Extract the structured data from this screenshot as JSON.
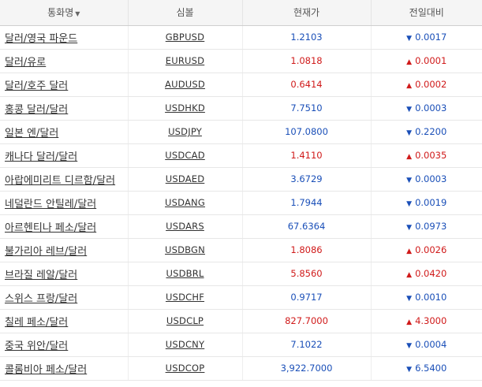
{
  "header": {
    "name": "통화명",
    "sort_icon": "▼",
    "symbol": "심볼",
    "price": "현재가",
    "change": "전일대비"
  },
  "colors": {
    "up": "#d01a1a",
    "down": "#1a4fb8"
  },
  "rows": [
    {
      "name": "달러/영국 파운드",
      "symbol": "GBPUSD",
      "price": "1.2103",
      "dir": "down",
      "arrow": "▼",
      "change": "0.0017"
    },
    {
      "name": "달러/유로",
      "symbol": "EURUSD",
      "price": "1.0818",
      "dir": "up",
      "arrow": "▲",
      "change": "0.0001"
    },
    {
      "name": "달러/호주 달러",
      "symbol": "AUDUSD",
      "price": "0.6414",
      "dir": "up",
      "arrow": "▲",
      "change": "0.0002"
    },
    {
      "name": "홍콩 달러/달러",
      "symbol": "USDHKD",
      "price": "7.7510",
      "dir": "down",
      "arrow": "▼",
      "change": "0.0003"
    },
    {
      "name": "일본 엔/달러",
      "symbol": "USDJPY",
      "price": "107.0800",
      "dir": "down",
      "arrow": "▼",
      "change": "0.2200"
    },
    {
      "name": "캐나다 달러/달러",
      "symbol": "USDCAD",
      "price": "1.4110",
      "dir": "up",
      "arrow": "▲",
      "change": "0.0035"
    },
    {
      "name": "아랍에미리트 디르함/달러",
      "symbol": "USDAED",
      "price": "3.6729",
      "dir": "down",
      "arrow": "▼",
      "change": "0.0003"
    },
    {
      "name": "네덜란드 안틸레/달러",
      "symbol": "USDANG",
      "price": "1.7944",
      "dir": "down",
      "arrow": "▼",
      "change": "0.0019"
    },
    {
      "name": "아르헨티나 페소/달러",
      "symbol": "USDARS",
      "price": "67.6364",
      "dir": "down",
      "arrow": "▼",
      "change": "0.0973"
    },
    {
      "name": "불가리아 레브/달러",
      "symbol": "USDBGN",
      "price": "1.8086",
      "dir": "up",
      "arrow": "▲",
      "change": "0.0026"
    },
    {
      "name": "브라질 레알/달러",
      "symbol": "USDBRL",
      "price": "5.8560",
      "dir": "up",
      "arrow": "▲",
      "change": "0.0420"
    },
    {
      "name": "스위스 프랑/달러",
      "symbol": "USDCHF",
      "price": "0.9717",
      "dir": "down",
      "arrow": "▼",
      "change": "0.0010"
    },
    {
      "name": "칠레 페소/달러",
      "symbol": "USDCLP",
      "price": "827.7000",
      "dir": "up",
      "arrow": "▲",
      "change": "4.3000"
    },
    {
      "name": "중국 위안/달러",
      "symbol": "USDCNY",
      "price": "7.1022",
      "dir": "down",
      "arrow": "▼",
      "change": "0.0004"
    },
    {
      "name": "콜롬비아 페소/달러",
      "symbol": "USDCOP",
      "price": "3,922.7000",
      "dir": "down",
      "arrow": "▼",
      "change": "6.5400"
    }
  ]
}
